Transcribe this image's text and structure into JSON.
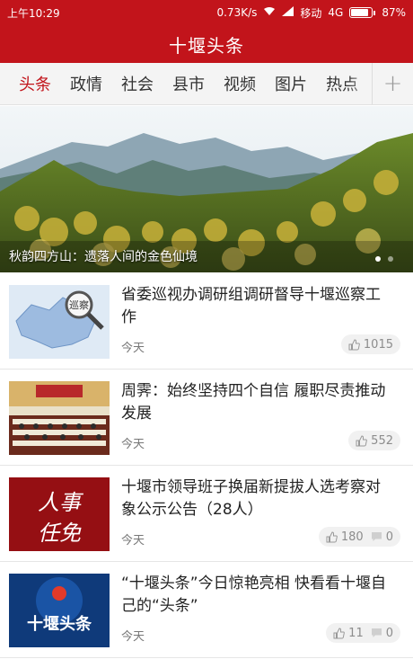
{
  "status_bar": {
    "time": "上午10:29",
    "network_speed": "0.73K/s",
    "carrier": "移动",
    "network_type": "4G",
    "battery": "87%",
    "battery_level": 0.87
  },
  "app": {
    "title": "十堰头条"
  },
  "tabs": [
    {
      "label": "头条",
      "active": true
    },
    {
      "label": "政情",
      "active": false
    },
    {
      "label": "社会",
      "active": false
    },
    {
      "label": "县市",
      "active": false
    },
    {
      "label": "视频",
      "active": false
    },
    {
      "label": "图片",
      "active": false
    },
    {
      "label": "热点",
      "active": false
    }
  ],
  "tab_add_label": "+",
  "banner": {
    "caption": "秋韵四方山：遗落人间的金色仙境",
    "slide_count": 2,
    "active_slide": 0
  },
  "news": [
    {
      "title": "省委巡视办调研组调研督导十堰巡察工作",
      "time": "今天",
      "likes": "1015",
      "comments": null,
      "thumb_text": "巡察"
    },
    {
      "title": "周霁：始终坚持四个自信 履职尽责推动发展",
      "time": "今天",
      "likes": "552",
      "comments": null,
      "thumb_text": ""
    },
    {
      "title": "十堰市领导班子换届新提拔人选考察对象公示公告（28人）",
      "time": "今天",
      "likes": "180",
      "comments": "0",
      "thumb_text": "人事任免"
    },
    {
      "title": "“十堰头条”今日惊艳亮相 快看看十堰自己的“头条”",
      "time": "今天",
      "likes": "11",
      "comments": "0",
      "thumb_text": "十堰头条"
    }
  ],
  "colors": {
    "brand_red": "#c2141b",
    "tab_active": "#c2141b",
    "muted_text": "#777777"
  }
}
